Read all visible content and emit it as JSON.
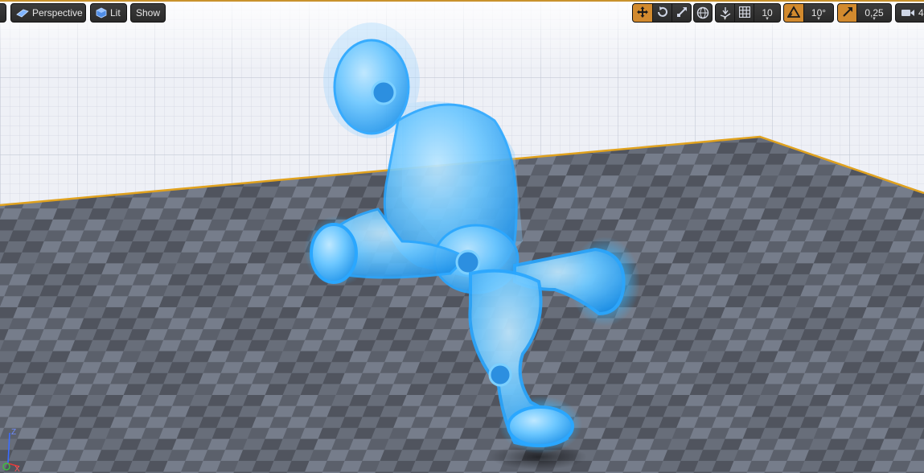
{
  "toolbar": {
    "view_mode_label": "Perspective",
    "lighting_label": "Lit",
    "show_label": "Show",
    "grid_snap_value": "10",
    "rotation_snap_value": "10°",
    "scale_snap_value": "0,25",
    "camera_speed_value": "4"
  },
  "icons": {
    "perspective": "perspective-cube-icon",
    "lit": "lit-sphere-icon",
    "translate": "translate-icon",
    "rotate": "rotate-icon",
    "scale": "scale-icon",
    "world": "world-icon",
    "surface_snap": "surface-snap-icon",
    "grid": "grid-icon",
    "rotation_snap": "rotation-snap-icon",
    "scale_snap": "scale-snap-icon",
    "camera": "camera-speed-icon"
  },
  "axis": {
    "z_label": "Z",
    "x_label": "X"
  },
  "colors": {
    "active_tool": "#d28a2e",
    "toolbar_bg": "#2d2d2d",
    "mannequin": "#3fb4ff",
    "floor_light": "#6e7583",
    "floor_dark": "#4a4f5a",
    "grid_bg": "#eef0f6"
  }
}
